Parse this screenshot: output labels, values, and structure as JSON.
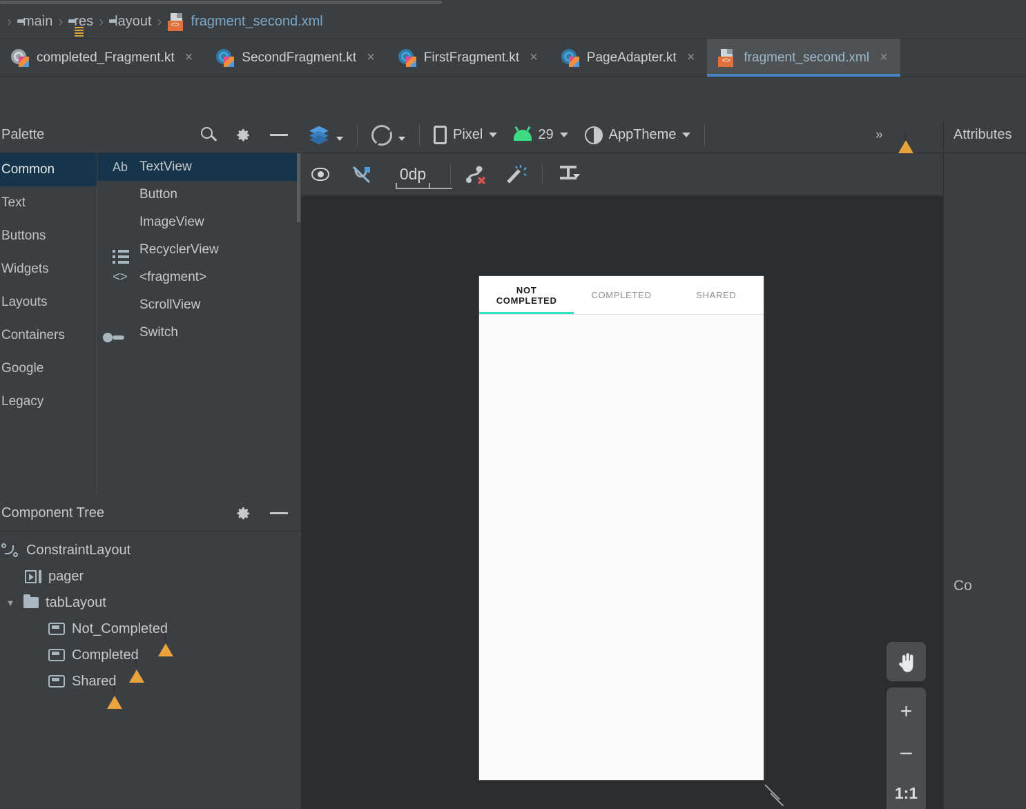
{
  "breadcrumb": {
    "items": [
      {
        "label": "main",
        "icon": "folder-icon"
      },
      {
        "label": "res",
        "icon": "res-folder-icon"
      },
      {
        "label": "layout",
        "icon": "layout-folder-icon"
      },
      {
        "label": "fragment_second.xml",
        "icon": "xml-file-icon"
      }
    ],
    "separator": "›"
  },
  "editor_tabs": [
    {
      "label": "completed_Fragment.kt",
      "icon": "kotlin-file-icon",
      "active": false,
      "close": "×"
    },
    {
      "label": "SecondFragment.kt",
      "icon": "kotlin-file-icon",
      "active": false,
      "close": "×"
    },
    {
      "label": "FirstFragment.kt",
      "icon": "kotlin-file-icon",
      "active": false,
      "close": "×"
    },
    {
      "label": "PageAdapter.kt",
      "icon": "kotlin-file-icon",
      "active": false,
      "close": "×"
    },
    {
      "label": "fragment_second.xml",
      "icon": "xml-file-icon",
      "active": true,
      "close": "×"
    }
  ],
  "palette": {
    "title": "Palette",
    "search_icon": "search-icon",
    "settings_icon": "gear-icon",
    "minimize_icon": "minimize-icon",
    "categories": [
      {
        "label": "Common",
        "selected": true
      },
      {
        "label": "Text",
        "selected": false
      },
      {
        "label": "Buttons",
        "selected": false
      },
      {
        "label": "Widgets",
        "selected": false
      },
      {
        "label": "Layouts",
        "selected": false
      },
      {
        "label": "Containers",
        "selected": false
      },
      {
        "label": "Google",
        "selected": false
      },
      {
        "label": "Legacy",
        "selected": false
      }
    ],
    "items": [
      {
        "label": "TextView",
        "icon": "ab-text-icon",
        "selected": true
      },
      {
        "label": "Button",
        "icon": "button-icon",
        "selected": false
      },
      {
        "label": "ImageView",
        "icon": "image-icon",
        "selected": false
      },
      {
        "label": "RecyclerView",
        "icon": "list-icon",
        "selected": false
      },
      {
        "label": "<fragment>",
        "icon": "code-brackets-icon",
        "selected": false
      },
      {
        "label": "ScrollView",
        "icon": "scrollview-icon",
        "selected": false
      },
      {
        "label": "Switch",
        "icon": "switch-icon",
        "selected": false
      }
    ]
  },
  "component_tree": {
    "title": "Component Tree",
    "settings_icon": "gear-icon",
    "minimize_icon": "minimize-icon",
    "nodes": [
      {
        "label": "ConstraintLayout",
        "icon": "constraint-layout-icon",
        "depth": 0,
        "expanded": null,
        "warning": false
      },
      {
        "label": "pager",
        "icon": "viewpager-icon",
        "depth": 1,
        "expanded": null,
        "warning": false
      },
      {
        "label": "tabLayout",
        "icon": "folder-icon",
        "depth": 1,
        "expanded": true,
        "warning": false
      },
      {
        "label": "Not_Completed",
        "icon": "tab-item-icon",
        "depth": 2,
        "expanded": null,
        "warning": true
      },
      {
        "label": "Completed",
        "icon": "tab-item-icon",
        "depth": 2,
        "expanded": null,
        "warning": true
      },
      {
        "label": "Shared",
        "icon": "tab-item-icon",
        "depth": 2,
        "expanded": null,
        "warning": true
      }
    ],
    "collapse_caret": "▼"
  },
  "design_toolbar": {
    "view_mode_icon": "layers-icon",
    "orientation_icon": "rotate-device-icon",
    "device": {
      "label": "Pixel",
      "icon": "phone-icon",
      "chevron": "⌄"
    },
    "api": {
      "label": "29",
      "icon": "android-icon",
      "chevron": "⌄"
    },
    "theme": {
      "label": "AppTheme",
      "icon": "theme-icon",
      "chevron": "⌄"
    },
    "overflow": "»",
    "warning_icon": "warning-icon"
  },
  "constraint_toolbar": {
    "show_constraints_icon": "eye-icon",
    "autoconnect_icon": "autoconnect-off-icon",
    "default_margin_value": "0dp",
    "clear_constraints_icon": "clear-constraints-icon",
    "infer_constraints_icon": "magic-wand-icon",
    "align_icon": "align-vertical-icon"
  },
  "device_preview": {
    "tabs": [
      {
        "label": "NOT COMPLETED",
        "line1": "NOT",
        "line2": "COMPLETED",
        "selected": true
      },
      {
        "label": "COMPLETED",
        "line1": "COMPLETED",
        "line2": "",
        "selected": false
      },
      {
        "label": "SHARED",
        "line1": "SHARED",
        "line2": "",
        "selected": false
      }
    ],
    "indicator_color": "#31dfc6",
    "resize_handle_icon": "resize-handle-icon"
  },
  "zoom_controls": {
    "pan_icon": "pan-hand-icon",
    "zoom_in": "+",
    "zoom_out": "–",
    "zoom_fit": "1:1"
  },
  "attributes_panel": {
    "title": "Attributes",
    "clipped_label": "Co"
  },
  "colors": {
    "panel_bg": "#3c3f41",
    "surface_bg": "#2b2d2f",
    "selection_blue": "#16344a",
    "tab_underline": "#4a88c7",
    "warning_amber": "#e8a33d",
    "android_green": "#3ddc84",
    "xml_orange": "#e2703a",
    "teal_indicator": "#31dfc6"
  }
}
